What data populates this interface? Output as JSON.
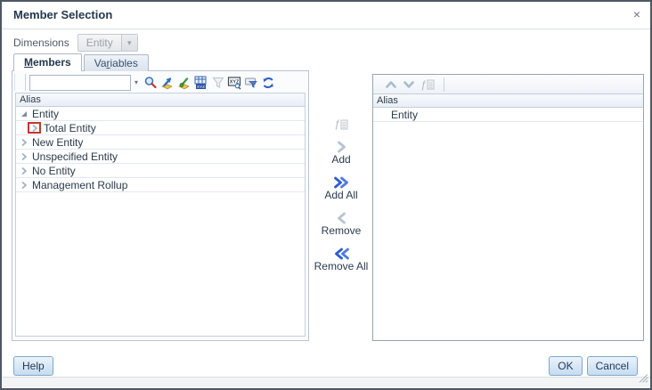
{
  "dialog": {
    "title": "Member Selection"
  },
  "icons": {
    "close": "×",
    "combo_arrow": "▾",
    "search_dropdown_arrow": "▾",
    "fx": "ƒ",
    "xyz": "XYZ",
    "toolbar_icon_names": [
      "search-icon",
      "find-member-icon",
      "find-function-icon",
      "xyz-table-icon",
      "filter-icon",
      "xyz-search-icon",
      "filter-select-icon",
      "refresh-icon"
    ],
    "right_toolbar_icon_names": [
      "move-up-icon",
      "move-down-icon",
      "function-icon"
    ]
  },
  "dimensions": {
    "label": "Dimensions",
    "value": "Entity"
  },
  "tabs": {
    "members": {
      "pre": "",
      "mnemonic": "M",
      "rest": "embers"
    },
    "variables": {
      "pre": "Va",
      "mnemonic": "r",
      "rest": "iables"
    }
  },
  "left_panel": {
    "search_value": "",
    "column_header": "Alias",
    "tree": {
      "root": "Entity",
      "children": [
        "Total Entity",
        "New Entity",
        "Unspecified Entity",
        "No Entity",
        "Management Rollup"
      ]
    }
  },
  "actions": {
    "add": "Add",
    "add_all": "Add All",
    "remove": "Remove",
    "remove_all": "Remove All"
  },
  "right_panel": {
    "column_header": "Alias",
    "rows": [
      "Entity"
    ]
  },
  "footer": {
    "help": "Help",
    "ok": "OK",
    "cancel": "Cancel"
  },
  "colors": {
    "accent_blue": "#2e5ed0",
    "disabled_chevron": "#b9c4d1",
    "highlight_red": "#c0392b",
    "button_border": "#7da7cd"
  }
}
